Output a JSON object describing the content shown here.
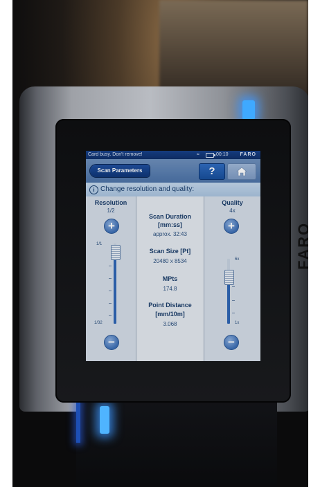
{
  "status_bar": {
    "message": "Card busy. Don't remove!",
    "time": "00:10",
    "brand": "FARO"
  },
  "toolbar": {
    "back_button_label": "Scan Parameters",
    "help_label": "?"
  },
  "info": {
    "text": "Change resolution and quality:"
  },
  "resolution": {
    "title": "Resolution",
    "value": "1/2",
    "max_label": "1/1",
    "min_label": "1/32"
  },
  "quality": {
    "title": "Quality",
    "value": "4x",
    "max_label": "6x",
    "min_label": "1x"
  },
  "stats": {
    "duration_label": "Scan Duration",
    "duration_unit": "[mm:ss]",
    "duration_value": "approx. 32:43",
    "size_label": "Scan Size [Pt]",
    "size_value": "20480 x 8534",
    "mpts_label": "MPts",
    "mpts_value": "174.8",
    "distance_label": "Point Distance",
    "distance_unit": "[mm/10m]",
    "distance_value": "3.068"
  },
  "device": {
    "faro_label": "FARO"
  },
  "colors": {
    "accent": "#1f4fa0",
    "led": "#3fa9ff"
  }
}
